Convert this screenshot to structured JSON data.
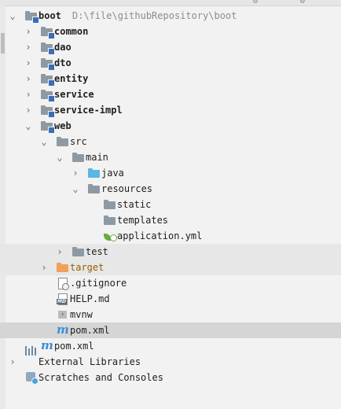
{
  "tree": {
    "root": {
      "label": "boot",
      "path": "D:\\file\\githubRepository\\boot"
    },
    "modules": [
      "common",
      "dao",
      "dto",
      "entity",
      "service",
      "service-impl",
      "web"
    ],
    "src": "src",
    "main": "main",
    "java": "java",
    "resources": "resources",
    "static": "static",
    "templates": "templates",
    "application_yml": "application.yml",
    "test": "test",
    "target": "target",
    "gitignore": ".gitignore",
    "help_md": "HELP.md",
    "mvnw": "mvnw",
    "web_pom": "pom.xml",
    "root_pom": "pom.xml",
    "external_libraries": "External Libraries",
    "scratches": "Scratches and Consoles"
  }
}
